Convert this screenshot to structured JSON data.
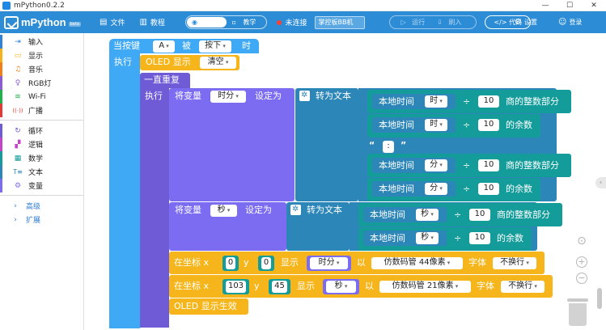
{
  "window": {
    "title": "mPython0.2.2",
    "controls": [
      "—",
      "☐",
      "✕"
    ]
  },
  "toolbar": {
    "logo_text": "mPython",
    "logo_badge": "beta",
    "file_label": "文件",
    "tutorial_label": "教程",
    "mode_normal": "普通",
    "mode_teach": "教学",
    "connection_status": "未连接",
    "board_name": "掌控板BB机",
    "run_label": "运行",
    "flash_label": "刷入",
    "code_label": "代码",
    "settings_label": "设置",
    "login_label": "登录"
  },
  "colors": {
    "toolbar": "#2d8cd6",
    "event_block": "#3fa9f5",
    "oled_block": "#f6b61b",
    "loop_block": "#6f5bd6",
    "variable_block": "#7b6cf2",
    "text_block": "#2d86b8",
    "math_block": "#139c9a"
  },
  "sidebar": {
    "items": [
      {
        "label": "输入",
        "icon": "⇥",
        "color": "#2f80d9"
      },
      {
        "label": "显示",
        "icon": "▭",
        "color": "#f5b31b"
      },
      {
        "label": "音乐",
        "icon": "♫",
        "color": "#f07f1a"
      },
      {
        "label": "RGB灯",
        "icon": "♀",
        "color": "#8e5bd8"
      },
      {
        "label": "Wi-Fi",
        "icon": "≋",
        "color": "#20b24a"
      },
      {
        "label": "广播",
        "icon": "((·))",
        "color": "#e53935"
      },
      {
        "label": "循环",
        "icon": "↻",
        "color": "#6f5bd6"
      },
      {
        "label": "逻辑",
        "icon": "▞",
        "color": "#c245c8"
      },
      {
        "label": "数学",
        "icon": "▦",
        "color": "#139c9a"
      },
      {
        "label": "文本",
        "icon": "T≡",
        "color": "#2d86b8"
      },
      {
        "label": "变量",
        "icon": "⚙",
        "color": "#7b6cf2"
      }
    ],
    "sub_items": [
      {
        "label": "高级",
        "icon": "›"
      },
      {
        "label": "扩展",
        "icon": "›"
      }
    ]
  },
  "blocks": {
    "event": {
      "when_key": "当按键",
      "key": "A",
      "by": "被",
      "action": "按下",
      "then": "时",
      "exec": "执行"
    },
    "oled_clear": {
      "label": "OLED 显示",
      "option": "清空"
    },
    "forever": {
      "label": "一直重复",
      "exec": "执行"
    },
    "set_var": "将变量",
    "set_to": "设定为",
    "to_text": "转为文本",
    "local_time": "本地时间",
    "div": "÷",
    "quotient": "商的整数部分",
    "remainder": "的余数",
    "var_hm": "时分",
    "var_sec": "秒",
    "hour": "时",
    "minute": "分",
    "second": "秒",
    "ten": "10",
    "colon_open": "“",
    "colon_text": ":",
    "colon_close": "”",
    "draw1": {
      "at": "在坐标 x",
      "x": "0",
      "y_label": "y",
      "y": "0",
      "show": "显示",
      "var": "时分",
      "with": "以",
      "font": "仿数码管 44像素",
      "font_label": "字体",
      "wrap": "不换行"
    },
    "draw2": {
      "at": "在坐标 x",
      "x": "103",
      "y_label": "y",
      "y": "45",
      "show": "显示",
      "var": "秒",
      "with": "以",
      "font": "仿数码管 21像素",
      "font_label": "字体",
      "wrap": "不换行"
    },
    "oled_show": "OLED 显示生效"
  },
  "workspace_tools": {
    "center": "⊙",
    "zoom_in": "+",
    "zoom_out": "−",
    "collapse": "‹"
  }
}
